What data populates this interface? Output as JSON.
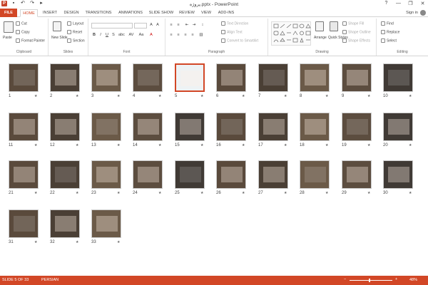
{
  "titlebar": {
    "ppt_label": "P",
    "title": "پروژه.pptx - PowerPoint",
    "undo": "↶",
    "redo": "↷",
    "help": "?",
    "minimize": "—",
    "restore": "❐",
    "close": "✕"
  },
  "tabs": [
    {
      "label": "FILE"
    },
    {
      "label": "HOME"
    },
    {
      "label": "INSERT"
    },
    {
      "label": "DESIGN"
    },
    {
      "label": "TRANSITIONS"
    },
    {
      "label": "ANIMATIONS"
    },
    {
      "label": "SLIDE SHOW"
    },
    {
      "label": "REVIEW"
    },
    {
      "label": "VIEW"
    },
    {
      "label": "ADD-INS"
    }
  ],
  "signin": "Sign in",
  "ribbon": {
    "clipboard": {
      "label": "Clipboard",
      "paste": "Paste",
      "cut": "Cut",
      "copy": "Copy",
      "format_painter": "Format Painter"
    },
    "slides": {
      "label": "Slides",
      "new_slide": "New Slide",
      "layout": "Layout",
      "reset": "Reset",
      "section": "Section"
    },
    "font": {
      "label": "Font",
      "bold": "B",
      "italic": "I",
      "underline": "U",
      "strike": "S",
      "size_up": "A",
      "size_down": "A",
      "clear": "A"
    },
    "paragraph": {
      "label": "Paragraph",
      "text_direction": "Text Direction",
      "align_text": "Align Text",
      "convert": "Convert to SmartArt"
    },
    "drawing": {
      "label": "Drawing",
      "arrange": "Arrange",
      "quick_styles": "Quick Styles",
      "shape_fill": "Shape Fill",
      "shape_outline": "Shape Outline",
      "shape_effects": "Shape Effects"
    },
    "editing": {
      "label": "Editing",
      "find": "Find",
      "replace": "Replace",
      "select": "Select"
    }
  },
  "slides": [
    {
      "number": "1"
    },
    {
      "number": "2"
    },
    {
      "number": "3"
    },
    {
      "number": "4"
    },
    {
      "number": "5"
    },
    {
      "number": "6"
    },
    {
      "number": "7"
    },
    {
      "number": "8"
    },
    {
      "number": "9"
    },
    {
      "number": "10"
    },
    {
      "number": "11"
    },
    {
      "number": "12"
    },
    {
      "number": "13"
    },
    {
      "number": "14"
    },
    {
      "number": "15"
    },
    {
      "number": "16"
    },
    {
      "number": "17"
    },
    {
      "number": "18"
    },
    {
      "number": "19"
    },
    {
      "number": "20"
    },
    {
      "number": "21"
    },
    {
      "number": "22"
    },
    {
      "number": "23"
    },
    {
      "number": "24"
    },
    {
      "number": "25"
    },
    {
      "number": "26"
    },
    {
      "number": "27"
    },
    {
      "number": "28"
    },
    {
      "number": "29"
    },
    {
      "number": "30"
    },
    {
      "number": "31"
    },
    {
      "number": "32"
    },
    {
      "number": "33"
    }
  ],
  "selected_slide": "5",
  "transition_marker": "★",
  "status": {
    "slide_info": "SLIDE 5 OF 33",
    "language": "PERSIAN",
    "zoom": "48%",
    "zoom_out": "−",
    "zoom_in": "+"
  },
  "colors": {
    "accent": "#d24726",
    "selected_border": "#d24726"
  }
}
